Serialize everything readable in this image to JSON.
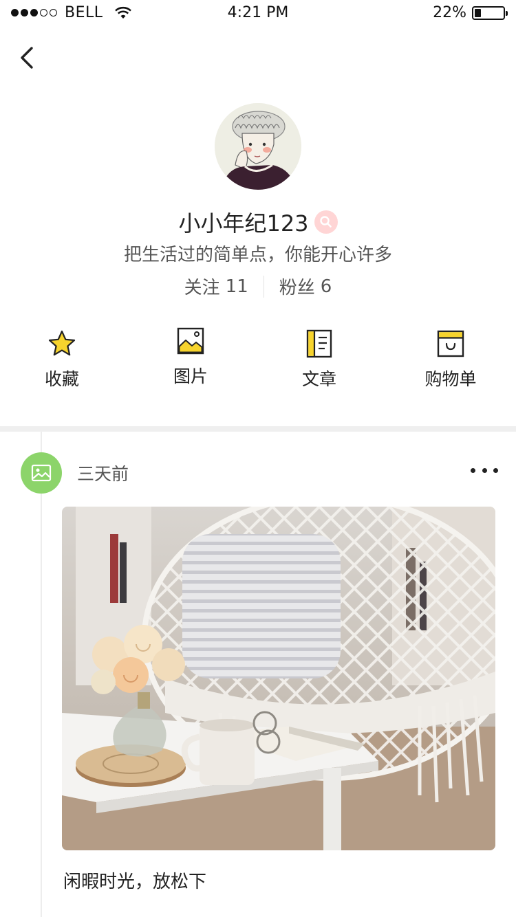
{
  "status_bar": {
    "carrier": "BELL",
    "time": "4:21 PM",
    "battery_text": "22%",
    "battery_level": 0.22,
    "signal_bars_filled": 3,
    "signal_bars_total": 5
  },
  "profile": {
    "name": "小小年纪123",
    "bio": "把生活过的简单点，你能开心许多",
    "following_label": "关注",
    "following_count": "11",
    "followers_label": "粉丝",
    "followers_count": "6"
  },
  "menu": [
    {
      "label": "收藏",
      "icon": "star-icon"
    },
    {
      "label": "图片",
      "icon": "picture-icon"
    },
    {
      "label": "文章",
      "icon": "article-icon"
    },
    {
      "label": "购物单",
      "icon": "shopping-bag-icon"
    }
  ],
  "post": {
    "time": "三天前",
    "caption": "闲暇时光，放松下",
    "type_icon": "image-icon"
  },
  "colors": {
    "accent_yellow": "#f7d42d",
    "post_icon_green": "#8cd46a",
    "badge_pink": "#ffd5d5"
  }
}
